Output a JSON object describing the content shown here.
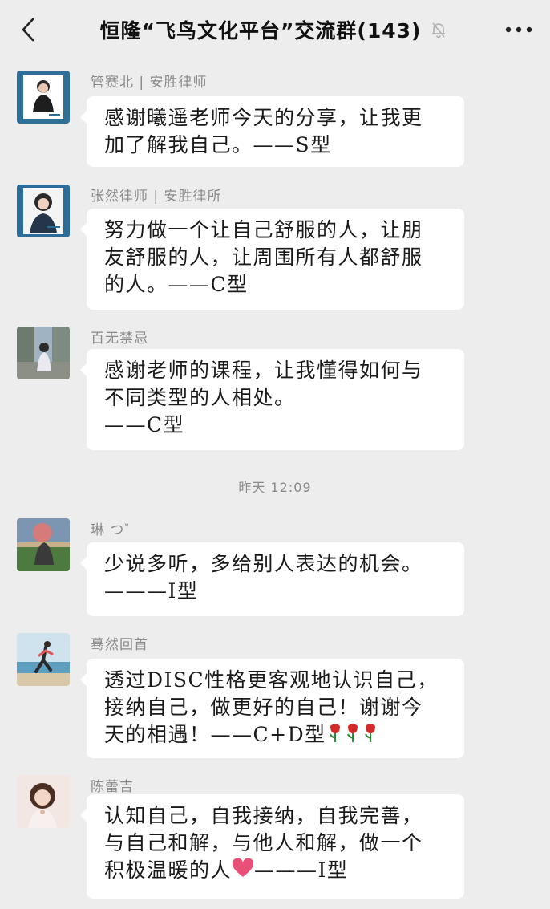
{
  "header": {
    "title": "恒隆“飞鸟文化平台”交流群(143)",
    "back_icon": "chevron-left-icon",
    "mute_icon": "bell-off-icon",
    "more_icon": "more-dots-icon"
  },
  "timestamp": "昨天 12:09",
  "messages": [
    {
      "sender": "管赛北 | 安胜律师",
      "lines": [
        "感谢曦遥老师今天的分享，让我更",
        "加了解我自己。——S型"
      ]
    },
    {
      "sender": "张然律师 | 安胜律所",
      "lines": [
        "努力做一个让自己舒服的人，让朋",
        "友舒服的人，让周围所有人都舒服",
        "的人。——C型"
      ]
    },
    {
      "sender": "百无禁忌",
      "lines": [
        "感谢老师的课程，让我懂得如何与",
        "不同类型的人相处。",
        "——C型"
      ]
    },
    {
      "sender": "琳 つ゛",
      "lines": [
        "少说多听，多给别人表达的机会。",
        "———I型"
      ]
    },
    {
      "sender": "蓦然回首",
      "lines": [
        "透过DISC性格更客观地认识自己，",
        "接纳自己，做更好的自己！谢谢今",
        "天的相遇！——C+D型"
      ]
    },
    {
      "sender": "陈蕾吉",
      "lines": [
        "认知自己，自我接纳，自我完善，",
        "与自己和解，与他人和解，做一个",
        "积极温暖的人"
      ],
      "line3_suffix": "———I型"
    }
  ],
  "colors": {
    "background": "#ededed",
    "bubble": "#ffffff",
    "meta_text": "#8a8a8a",
    "rose": "#d42a2a",
    "heart": "#e8507a"
  }
}
